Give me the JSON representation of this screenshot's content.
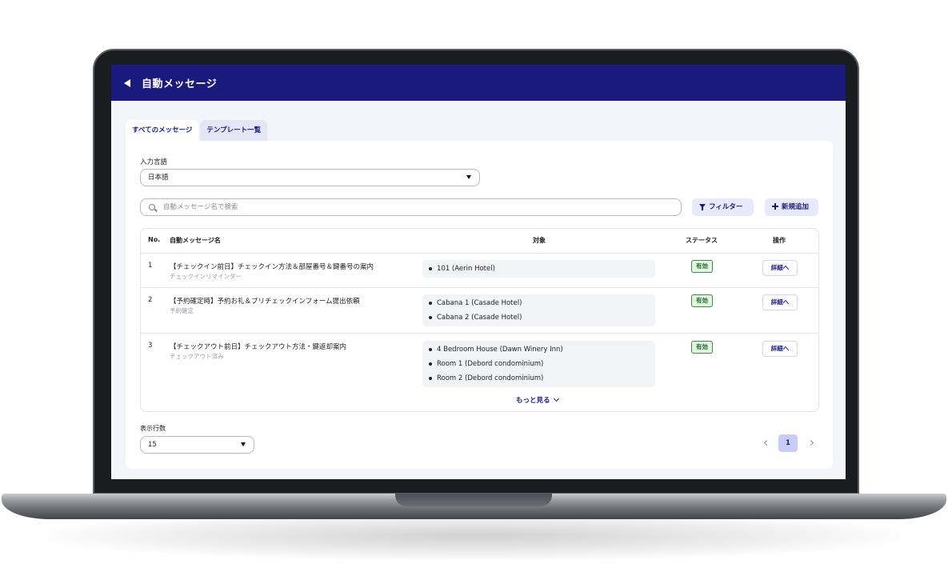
{
  "header": {
    "title": "自動メッセージ"
  },
  "tabs": [
    {
      "label": "すべてのメッセージ"
    },
    {
      "label": "テンプレート一覧"
    }
  ],
  "language": {
    "label": "入力言語",
    "value": "日本語"
  },
  "search": {
    "placeholder": "自動メッセージ名で検索"
  },
  "toolbar": {
    "filter_label": "フィルター",
    "add_label": "新規追加"
  },
  "table": {
    "headers": {
      "no": "No.",
      "name": "自動メッセージ名",
      "target": "対象",
      "status": "ステータス",
      "action": "操作"
    },
    "rows": [
      {
        "no": "1",
        "name": "【チェックイン前日】チェックイン方法＆部屋番号＆鍵番号の案内",
        "sub": "チェックインリマインダー",
        "targets": [
          "101 (Aerin Hotel)"
        ],
        "status": "有効",
        "action": "詳細へ"
      },
      {
        "no": "2",
        "name": "【予約確定時】予約お礼＆プリチェックインフォーム提出依頼",
        "sub": "予約確定",
        "targets": [
          "Cabana 1 (Casade Hotel)",
          "Cabana 2 (Casade Hotel)"
        ],
        "status": "有効",
        "action": "詳細へ"
      },
      {
        "no": "3",
        "name": "【チェックアウト前日】チェックアウト方法・鍵返却案内",
        "sub": "チェックアウト済み",
        "targets": [
          "4 Bedroom House (Dawn Winery Inn)",
          "Room 1 (Debord condominium)",
          "Room 2 (Debord condominium)"
        ],
        "status": "有効",
        "action": "詳細へ"
      }
    ],
    "more_label": "もっと見る"
  },
  "rows_per_page": {
    "label": "表示行数",
    "value": "15"
  },
  "pagination": {
    "current_page": "1"
  }
}
